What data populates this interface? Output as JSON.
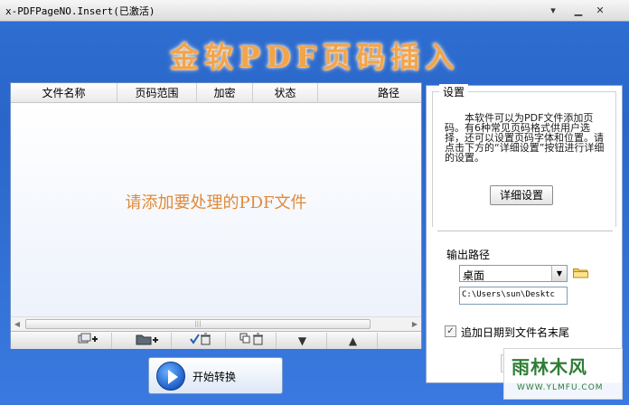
{
  "window": {
    "title": "x-PDFPageNO.Insert(已激活)",
    "buttons": {
      "menu": "▾",
      "minimize": "▁",
      "close": "✕"
    }
  },
  "banner": {
    "text": "金软PDF页码插入"
  },
  "file_list": {
    "columns": [
      "文件名称",
      "页码范围",
      "加密",
      "状态",
      "路径"
    ],
    "empty_hint": "请添加要处理的PDF文件",
    "scroll_grip": "|||"
  },
  "toolbar": {
    "tools": [
      {
        "name": "add-file",
        "icon": "add-file-icon",
        "glyph": "▭+"
      },
      {
        "name": "add-folder",
        "icon": "add-folder-icon",
        "glyph": "▰+"
      },
      {
        "name": "delete-checked",
        "icon": "delete-checked-icon",
        "glyph": "✓🗑"
      },
      {
        "name": "delete-all",
        "icon": "delete-all-icon",
        "glyph": "⧉🗑"
      },
      {
        "name": "move-down",
        "icon": "arrow-down-icon",
        "glyph": "⬇"
      },
      {
        "name": "move-up",
        "icon": "arrow-up-icon",
        "glyph": "⬆"
      }
    ]
  },
  "start_button": {
    "label": "开始转换"
  },
  "settings": {
    "legend": "设置",
    "description": "本软件可以为PDF文件添加页码。有6种常见页码格式供用户选择，还可以设置页码字体和位置。请点击下方的“详细设置”按钮进行详细的设置。",
    "detail_button": "详细设置",
    "output_label": "输出路径",
    "output_selected": "桌面",
    "output_path": "C:\\Users\\sun\\Desktc",
    "append_date_label": "追加日期到文件名末尾",
    "append_date_checked": true
  },
  "watermark": {
    "main": "雨林木风",
    "sub": "WWW.YLMFU.COM"
  },
  "colors": {
    "banner": "#f3a44a",
    "hint": "#e08a3b",
    "background": "#2a66c9"
  }
}
